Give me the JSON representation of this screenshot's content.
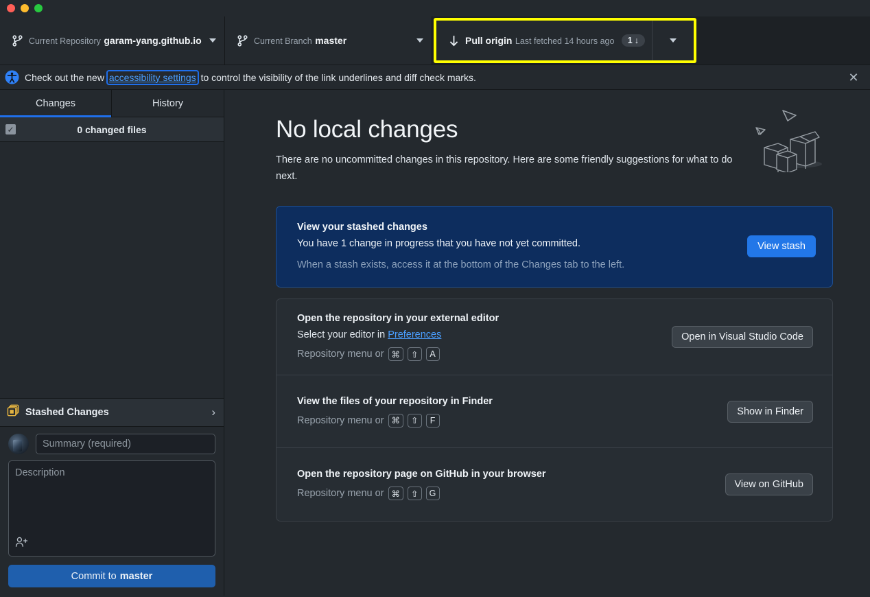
{
  "window": {
    "traffic_lights": [
      "close",
      "minimize",
      "maximize"
    ]
  },
  "toolbar": {
    "repository": {
      "label": "Current Repository",
      "value": "garam-yang.github.io",
      "icon": "repo-branch-icon"
    },
    "branch": {
      "label": "Current Branch",
      "value": "master",
      "icon": "repo-branch-icon"
    },
    "pull": {
      "title": "Pull origin",
      "subtitle": "Last fetched 14 hours ago",
      "badge_count": "1",
      "badge_arrow": "↓",
      "icon": "arrow-down-icon",
      "highlight_color": "#ffff00"
    }
  },
  "banner": {
    "icon": "accessibility-icon",
    "text_before": "Check out the new",
    "link": "accessibility settings",
    "text_after": "to control the visibility of the link underlines and diff check marks.",
    "close_label": "✕"
  },
  "sidebar": {
    "tabs": [
      {
        "label": "Changes",
        "active": true
      },
      {
        "label": "History",
        "active": false
      }
    ],
    "files_header": {
      "checkbox_glyph": "✓",
      "count_text": "0 changed files"
    },
    "stashed": {
      "label": "Stashed Changes",
      "icon": "stash-stack-icon",
      "chevron": "›"
    },
    "commit": {
      "avatar": "user-avatar",
      "summary_placeholder": "Summary (required)",
      "summary_value": "",
      "description_placeholder": "Description",
      "description_value": "",
      "coauthor_icon": "add-coauthor-icon",
      "button_prefix": "Commit to",
      "button_branch": "master"
    }
  },
  "main": {
    "headline": "No local changes",
    "subtext": "There are no uncommitted changes in this repository. Here are some friendly suggestions for what to do next.",
    "illustration": "boxes-and-paper-planes-illustration",
    "stash_card": {
      "title": "View your stashed changes",
      "description": "You have 1 change in progress that you have not yet committed.",
      "hint": "When a stash exists, access it at the bottom of the Changes tab to the left.",
      "button": "View stash",
      "accent_color": "#2277e8",
      "background_color": "#0d2d5e"
    },
    "suggestions": [
      {
        "title": "Open the repository in your external editor",
        "sub_before": "Select your editor in",
        "sub_link": "Preferences",
        "menu_text": "Repository menu or",
        "keys": [
          "⌘",
          "⇧",
          "A"
        ],
        "button": "Open in Visual Studio Code"
      },
      {
        "title": "View the files of your repository in Finder",
        "sub_before": "",
        "sub_link": "",
        "menu_text": "Repository menu or",
        "keys": [
          "⌘",
          "⇧",
          "F"
        ],
        "button": "Show in Finder"
      },
      {
        "title": "Open the repository page on GitHub in your browser",
        "sub_before": "",
        "sub_link": "",
        "menu_text": "Repository menu or",
        "keys": [
          "⌘",
          "⇧",
          "G"
        ],
        "button": "View on GitHub"
      }
    ]
  }
}
